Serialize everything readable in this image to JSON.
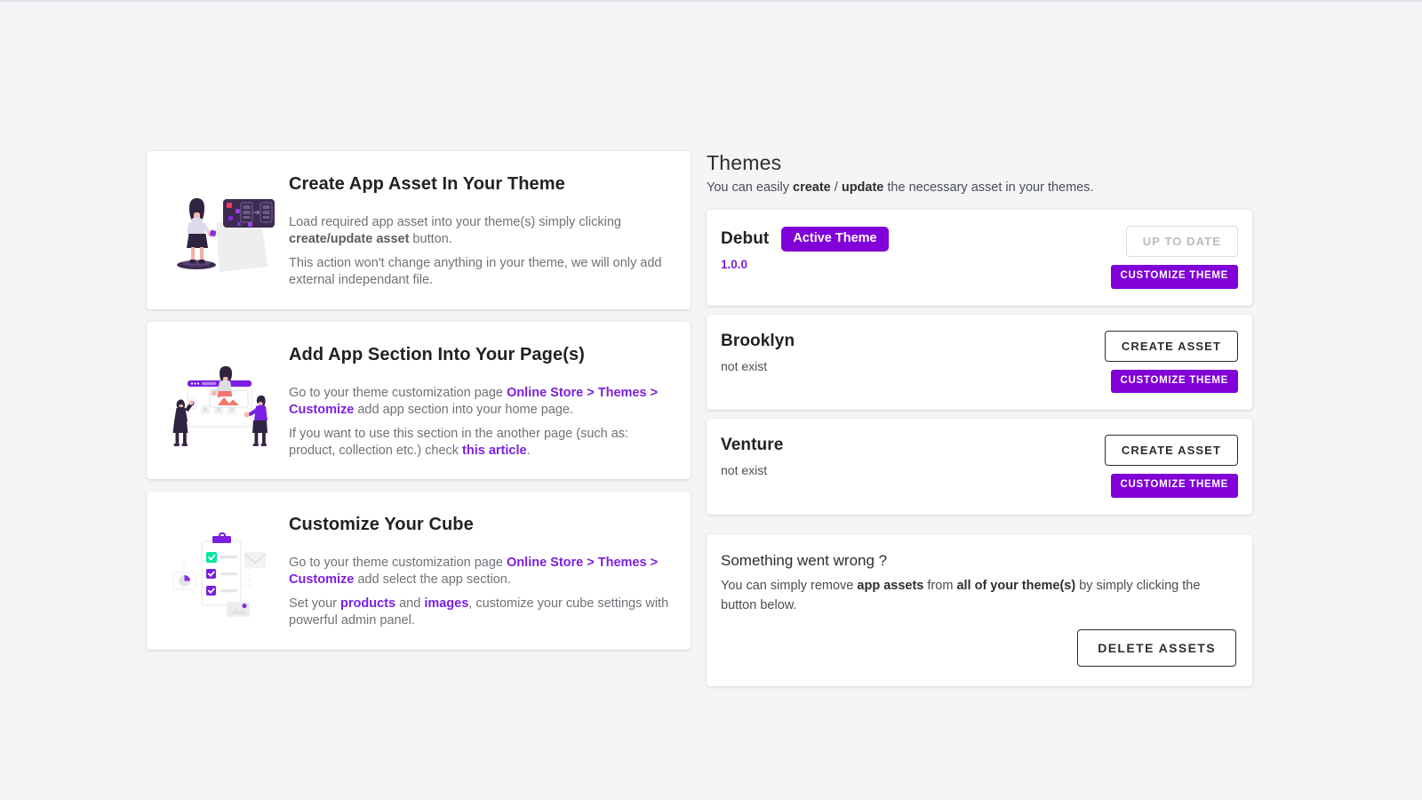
{
  "features": [
    {
      "illustration": "woman-presenting-dashboard-illustration",
      "title": "Create App Asset In Your Theme",
      "p1_a": "Load required app asset into your theme(s) simply clicking ",
      "p1_b": "create/update asset",
      "p1_c": " button.",
      "p2": "This action won't change anything in your theme, we will only add external independant file."
    },
    {
      "illustration": "people-building-webpage-illustration",
      "title": "Add App Section Into Your Page(s)",
      "p1_a": "Go to your theme customization page ",
      "p1_b": "Online Store > Themes > Customize",
      "p1_c": " add app section into your home page.",
      "p2_a": "If you want to use this section in the another page (such as: product, collection etc.) check ",
      "p2_b": "this article",
      "p2_c": "."
    },
    {
      "illustration": "clipboard-checklist-illustration",
      "title": "Customize Your Cube",
      "p1_a": "Go to your theme customization page ",
      "p1_b": "Online Store > Themes > Customize",
      "p1_c": " add select the app section.",
      "p2_a": "Set your ",
      "p2_b": "products",
      "p2_c": " and ",
      "p2_d": "images",
      "p2_e": ", customize your cube settings with powerful admin panel."
    }
  ],
  "themes_panel": {
    "title": "Themes",
    "subtitle_a": "You can easily ",
    "subtitle_b": "create",
    "subtitle_c": " / ",
    "subtitle_d": "update",
    "subtitle_e": " the necessary asset in your themes.",
    "rows": [
      {
        "name": "Debut",
        "badge": "Active Theme",
        "version": "1.0.0",
        "status": "",
        "primary_action": "UP TO DATE",
        "primary_disabled": true,
        "secondary_action": "CUSTOMIZE THEME"
      },
      {
        "name": "Brooklyn",
        "badge": "",
        "version": "",
        "status": "not exist",
        "primary_action": "CREATE ASSET",
        "primary_disabled": false,
        "secondary_action": "CUSTOMIZE THEME"
      },
      {
        "name": "Venture",
        "badge": "",
        "version": "",
        "status": "not exist",
        "primary_action": "CREATE ASSET",
        "primary_disabled": false,
        "secondary_action": "CUSTOMIZE THEME"
      }
    ]
  },
  "trouble": {
    "title": "Something went wrong ?",
    "text_a": "You can simply remove ",
    "text_b": "app assets",
    "text_c": " from ",
    "text_d": "all of your theme(s)",
    "text_e": " by simply clicking the button below.",
    "delete_label": "DELETE ASSETS"
  },
  "colors": {
    "accent_purple": "#8000d7",
    "link_purple": "#7c1fe0",
    "page_background": "#f4f5f7",
    "card_background": "#ffffff",
    "text_dark": "#202223",
    "text_muted": "#6f7277",
    "accent_mint": "#00e5a0"
  }
}
